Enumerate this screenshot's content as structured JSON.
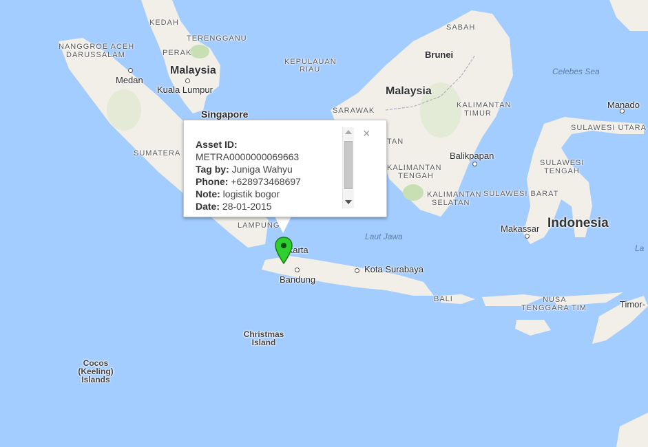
{
  "map": {
    "colors": {
      "water": "#a3ccff",
      "land": "#f2efe9",
      "green": "#c8dfb3",
      "marker": "#2fcf2f"
    },
    "labels": {
      "kedah": "KEDAH",
      "terengganu": "TERENGGANU",
      "nanggroe_aceh": "NANGGROE ACEH",
      "darussalam": "DARUSSALAM",
      "perak": "PERAK",
      "malaysia_west": "Malaysia",
      "medan": "Medan",
      "kuala_lumpur": "Kuala Lumpur",
      "singapore": "Singapore",
      "sumatera": "SUMATERA",
      "kepulauan": "KEPULAUAN",
      "riau": "RIAU",
      "sabah": "SABAH",
      "brunei": "Brunei",
      "malaysia_east": "Malaysia",
      "sarawak": "SARAWAK",
      "kalimantan_timur_1": "KALIMANTAN",
      "kalimantan_timur_2": "TIMUR",
      "kalimantan_tengah_1": "KALIMANTAN",
      "kalimantan_tengah_2": "TENGAH",
      "kalimantan_selatan_1": "KALIMANTAN",
      "kalimantan_selatan_2": "SELATAN",
      "kalimantan_barat_partial": "TAN",
      "celebes_sea": "Celebes Sea",
      "manado": "Manado",
      "sulawesi_utara": "SULAWESI UTARA",
      "sulawesi_tengah_1": "SULAWESI",
      "sulawesi_tengah_2": "TENGAH",
      "sulawesi_barat": "SULAWESI BARAT",
      "balikpapan": "Balikpapan",
      "makassar": "Makassar",
      "indonesia": "Indonesia",
      "lampung": "LAMPUNG",
      "laut_jawa": "Laut Jawa",
      "jakarta": "Jakarta",
      "bandung": "Bandung",
      "kota_surabaya": "Kota Surabaya",
      "bali": "BALI",
      "nusa_tenggara_1": "NUSA",
      "nusa_tenggara_2": "TENGGARA TIM",
      "timor": "Timor-",
      "christmas": "Christmas Island",
      "cocos": "Cocos (Keeling) Islands",
      "la": "La"
    }
  },
  "popup": {
    "asset_id_label": "Asset ID:",
    "asset_id_value": "METRA0000000069663",
    "tag_label": "Tag by:",
    "tag_value": "Juniga Wahyu",
    "phone_label": "Phone:",
    "phone_value": "+628973468697",
    "note_label": "Note:",
    "note_value": "logistik bogor",
    "date_label": "Date:",
    "date_value": "28-01-2015",
    "close_symbol": "×"
  },
  "marker": {
    "icon": "map-pin-icon",
    "color": "#2fcf2f"
  }
}
